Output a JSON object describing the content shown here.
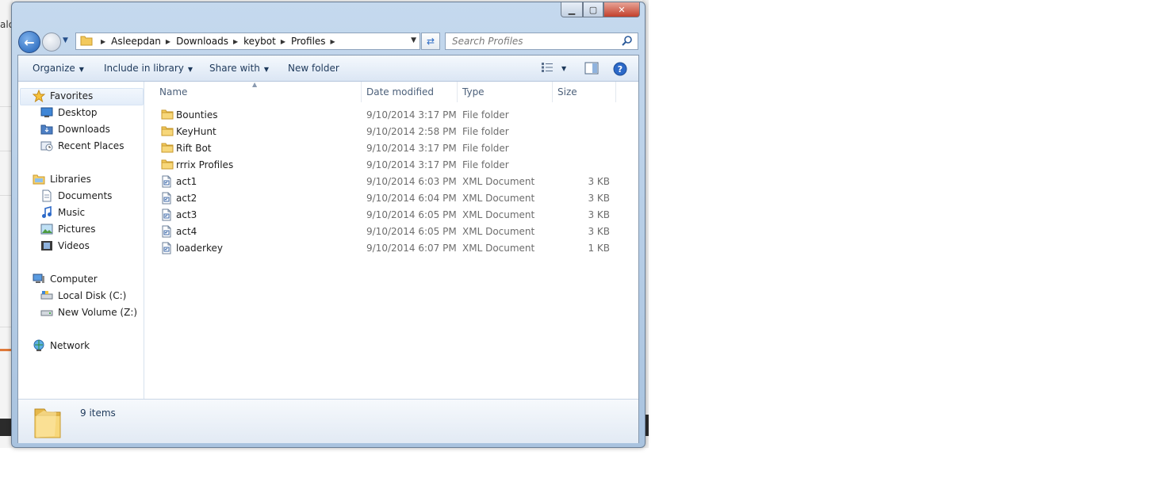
{
  "background": {
    "partial_text": "alo"
  },
  "window": {
    "caption": {
      "minimize": "▁",
      "maximize": "▢",
      "close": "✕"
    }
  },
  "address_bar": {
    "crumbs": [
      "Asleepdan",
      "Downloads",
      "keybot",
      "Profiles"
    ]
  },
  "search": {
    "placeholder": "Search Profiles"
  },
  "toolbar": {
    "organize": "Organize",
    "include_in_library": "Include in library",
    "share_with": "Share with",
    "new_folder": "New folder"
  },
  "nav": {
    "favorites": {
      "label": "Favorites",
      "items": [
        "Desktop",
        "Downloads",
        "Recent Places"
      ]
    },
    "libraries": {
      "label": "Libraries",
      "items": [
        "Documents",
        "Music",
        "Pictures",
        "Videos"
      ]
    },
    "computer": {
      "label": "Computer",
      "items": [
        "Local Disk (C:)",
        "New Volume (Z:)"
      ]
    },
    "network": {
      "label": "Network"
    }
  },
  "columns": {
    "name": "Name",
    "date": "Date modified",
    "type": "Type",
    "size": "Size"
  },
  "files": [
    {
      "name": "Bounties",
      "date": "9/10/2014 3:17 PM",
      "type": "File folder",
      "size": "",
      "icon": "folder-icon"
    },
    {
      "name": "KeyHunt",
      "date": "9/10/2014 2:58 PM",
      "type": "File folder",
      "size": "",
      "icon": "folder-icon"
    },
    {
      "name": "Rift Bot",
      "date": "9/10/2014 3:17 PM",
      "type": "File folder",
      "size": "",
      "icon": "folder-icon"
    },
    {
      "name": "rrrix Profiles",
      "date": "9/10/2014 3:17 PM",
      "type": "File folder",
      "size": "",
      "icon": "folder-icon"
    },
    {
      "name": "act1",
      "date": "9/10/2014 6:03 PM",
      "type": "XML Document",
      "size": "3 KB",
      "icon": "xml-file-icon"
    },
    {
      "name": "act2",
      "date": "9/10/2014 6:04 PM",
      "type": "XML Document",
      "size": "3 KB",
      "icon": "xml-file-icon"
    },
    {
      "name": "act3",
      "date": "9/10/2014 6:05 PM",
      "type": "XML Document",
      "size": "3 KB",
      "icon": "xml-file-icon"
    },
    {
      "name": "act4",
      "date": "9/10/2014 6:05 PM",
      "type": "XML Document",
      "size": "3 KB",
      "icon": "xml-file-icon"
    },
    {
      "name": "loaderkey",
      "date": "9/10/2014 6:07 PM",
      "type": "XML Document",
      "size": "1 KB",
      "icon": "xml-file-icon"
    }
  ],
  "status": {
    "count": "9 items"
  },
  "colors": {
    "accent": "#1e395b",
    "selection": "#e3edf9",
    "folder": "#f5cf6b"
  }
}
